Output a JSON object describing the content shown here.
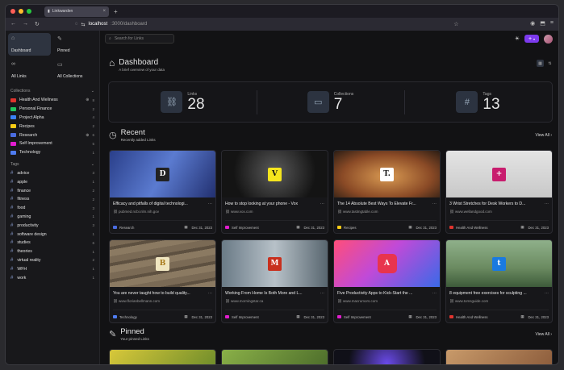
{
  "browser": {
    "tab_title": "Linkwarden",
    "url_host": "localhost",
    "url_path": ":3000/dashboard"
  },
  "sidebar": {
    "quick": [
      {
        "label": "Dashboard",
        "icon": "home-icon"
      },
      {
        "label": "Pinned",
        "icon": "pin-icon"
      },
      {
        "label": "All Links",
        "icon": "link-icon"
      },
      {
        "label": "All Collections",
        "icon": "folder-icon"
      }
    ],
    "collections_heading": "Collections",
    "collections": [
      {
        "name": "Health And Wellness",
        "color": "#e0342e",
        "count": "8",
        "shared": true
      },
      {
        "name": "Personal Finance",
        "color": "#22c55e",
        "count": "2",
        "shared": false
      },
      {
        "name": "Project Alpha",
        "color": "#3b82f6",
        "count": "4",
        "shared": false
      },
      {
        "name": "Recipes",
        "color": "#facc15",
        "count": "2",
        "shared": false
      },
      {
        "name": "Research",
        "color": "#4a6ce0",
        "count": "6",
        "shared": true
      },
      {
        "name": "Self Improvement",
        "color": "#e11dce",
        "count": "5",
        "shared": false
      },
      {
        "name": "Technology",
        "color": "#4f7cf0",
        "count": "1",
        "shared": false
      }
    ],
    "tags_heading": "Tags",
    "tags": [
      {
        "name": "advice",
        "count": "3"
      },
      {
        "name": "apple",
        "count": "1"
      },
      {
        "name": "finance",
        "count": "2"
      },
      {
        "name": "fitness",
        "count": "2"
      },
      {
        "name": "food",
        "count": "3"
      },
      {
        "name": "gaming",
        "count": "1"
      },
      {
        "name": "productivity",
        "count": "3"
      },
      {
        "name": "software design",
        "count": "1"
      },
      {
        "name": "studies",
        "count": "6"
      },
      {
        "name": "theories",
        "count": "1"
      },
      {
        "name": "virtual reality",
        "count": "2"
      },
      {
        "name": "WFH",
        "count": "1"
      },
      {
        "name": "work",
        "count": "1"
      }
    ]
  },
  "topbar": {
    "search_placeholder": "Search for Links",
    "add_label": "+"
  },
  "dashboard": {
    "title": "Dashboard",
    "subtitle": "A brief overview of your data",
    "stats": [
      {
        "label": "Links",
        "value": "28",
        "icon": "link-icon"
      },
      {
        "label": "Collections",
        "value": "7",
        "icon": "folder-icon"
      },
      {
        "label": "Tags",
        "value": "13",
        "icon": "hash-icon"
      }
    ]
  },
  "recent": {
    "title": "Recent",
    "subtitle": "Recently added Links",
    "view_all": "View All",
    "cards": [
      {
        "title": "Efficacy and pitfalls of digital technologi...",
        "url": "pubmed.ncbi.nlm.nih.gov",
        "collection": "Research",
        "color": "#4a6ce0",
        "date": "Dec 31, 2023",
        "fav": "D",
        "bg": "linear-gradient(120deg,#2a3f8a,#5b7bd0 50%,#223070)"
      },
      {
        "title": "How to stop looking at your phone - Vox",
        "url": "www.vox.com",
        "collection": "Self Improvement",
        "color": "#e11dce",
        "date": "Dec 31, 2023",
        "fav": "V",
        "bg": "radial-gradient(circle at 50% 45%,#5a5a5a,#141414 70%)"
      },
      {
        "title": "The 14 Absolute Best Ways To Elevate Fr...",
        "url": "www.tastingtable.com",
        "collection": "Recipes",
        "color": "#facc15",
        "date": "Dec 31, 2023",
        "fav": "T.",
        "bg": "radial-gradient(ellipse at 50% 55%,#d99a52,#8a4a26 60%,#2a1d14)"
      },
      {
        "title": "3 Wrist Stretches for Desk Workers to D...",
        "url": "www.wellandgood.com",
        "collection": "Health And Wellness",
        "color": "#e0342e",
        "date": "Dec 31, 2023",
        "fav": "+",
        "bg": "linear-gradient(180deg,#e4e4e4,#c8c8c8)"
      },
      {
        "title": "You are never taught how to build quality...",
        "url": "www.florianbellmann.com",
        "collection": "Technology",
        "color": "#4f7cf0",
        "date": "Dec 31, 2023",
        "fav": "B",
        "bg": "repeating-linear-gradient(170deg,#7a6a55 0 8px,#5d5040 8px 12px,#8b7a62 12px 20px)"
      },
      {
        "title": "Working From Home Is Both More and L...",
        "url": "www.morningstar.ca",
        "collection": "Self Improvement",
        "color": "#e11dce",
        "date": "Dec 31, 2023",
        "fav": "M",
        "bg": "linear-gradient(90deg,#6a7a86,#b7c1c8 50%,#58666f)"
      },
      {
        "title": "Five Productivity Apps to Kick-Start the ...",
        "url": "www.macrumors.com",
        "collection": "Self Improvement",
        "color": "#e11dce",
        "date": "Dec 31, 2023",
        "fav": "A",
        "bg": "linear-gradient(135deg,#ff4e7a,#c04ad8 45%,#3a6ae8)"
      },
      {
        "title": "8 equipment free exercises for sculpting ...",
        "url": "www.tomsguide.com",
        "collection": "Health And Wellness",
        "color": "#e0342e",
        "date": "Dec 31, 2023",
        "fav": "t",
        "bg": "linear-gradient(180deg,#8fb08a,#6a8a60 60%,#3d5a3a)"
      }
    ]
  },
  "pinned": {
    "title": "Pinned",
    "subtitle": "Your pinned Links",
    "view_all": "View All",
    "thumbs": [
      "linear-gradient(135deg,#d8c83a,#6a8a2a)",
      "linear-gradient(135deg,#8ab048,#4a6a2a)",
      "radial-gradient(circle at 50% 60%,#6a4ae8,#101018 70%)",
      "linear-gradient(135deg,#c89a6a,#8a5a3a)"
    ]
  }
}
